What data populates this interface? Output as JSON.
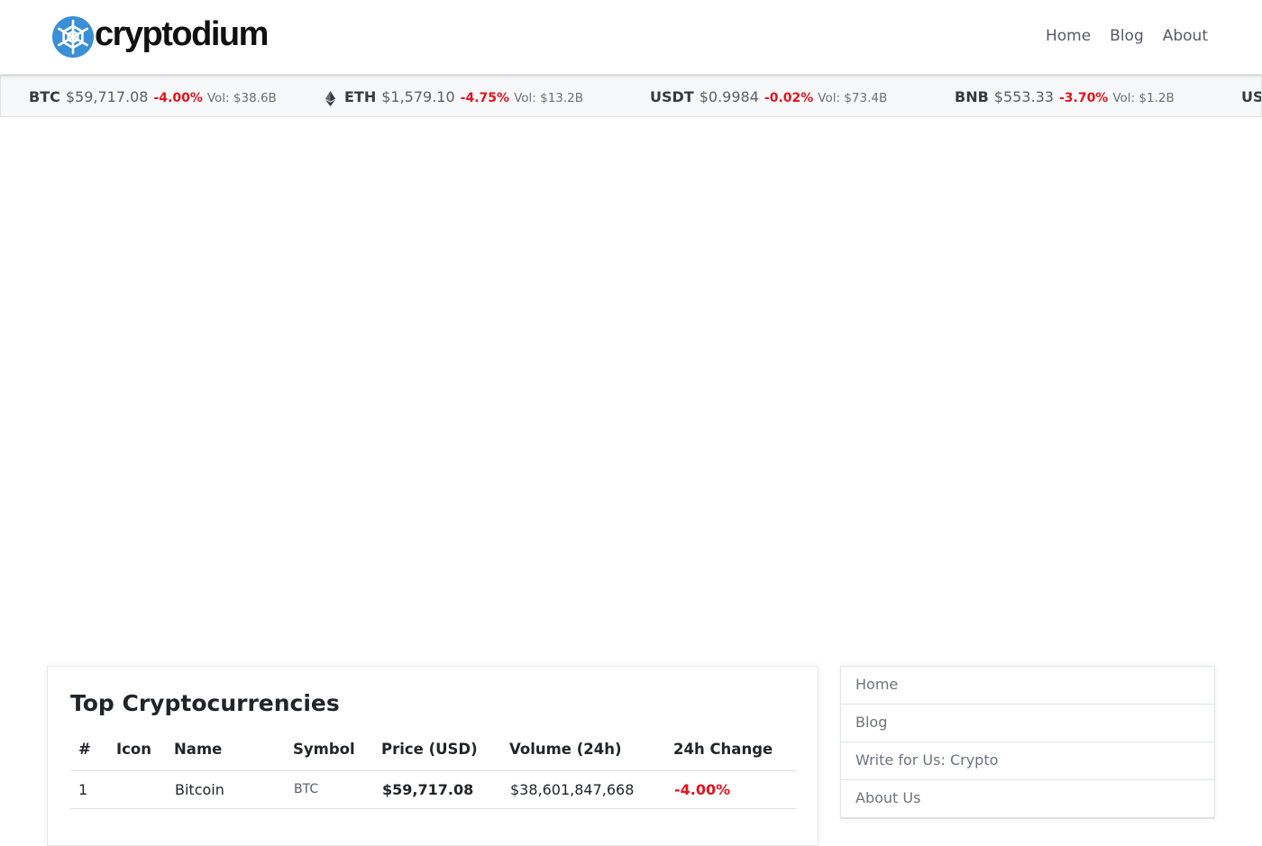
{
  "colors": {
    "brand_blue": "#3a8fd6",
    "negative": "#e5121d",
    "ticker_bg": "#f7f8f9"
  },
  "header": {
    "logo_text": "cryptodium",
    "logo_icon": "crypto-wheel-icon",
    "nav": [
      "Home",
      "Blog",
      "About"
    ]
  },
  "ticker": [
    {
      "symbol": "BTC",
      "price": "$59,717.08",
      "change": "-4.00%",
      "volume": "Vol: $38.6B"
    },
    {
      "symbol": "ETH",
      "price": "$1,579.10",
      "change": "-4.75%",
      "volume": "Vol: $13.2B",
      "icon": "ethereum-icon"
    },
    {
      "symbol": "USDT",
      "price": "$0.9984",
      "change": "-0.02%",
      "volume": "Vol: $73.4B"
    },
    {
      "symbol": "BNB",
      "price": "$553.33",
      "change": "-3.70%",
      "volume": "Vol: $1.2B"
    },
    {
      "symbol": "US"
    }
  ],
  "main": {
    "title": "Top Cryptocurrencies",
    "columns": [
      "#",
      "Icon",
      "Name",
      "Symbol",
      "Price (USD)",
      "Volume (24h)",
      "24h Change"
    ],
    "rows": [
      {
        "rank": "1",
        "name": "Bitcoin",
        "symbol": "BTC",
        "price": "$59,717.08",
        "volume": "$38,601,847,668",
        "change": "-4.00%"
      }
    ]
  },
  "sidebar": {
    "items": [
      "Home",
      "Blog",
      "Write for Us: Crypto",
      "About Us"
    ]
  }
}
